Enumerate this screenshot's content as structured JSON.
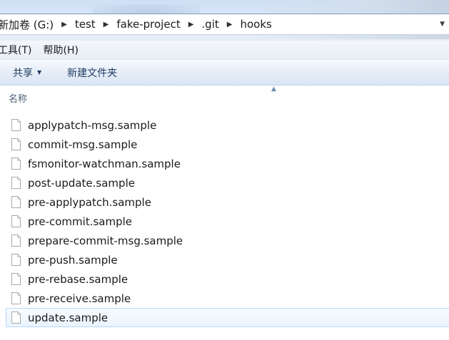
{
  "address": {
    "crumbs": [
      "新加卷 (G:)",
      "test",
      "fake-project",
      ".git",
      "hooks"
    ],
    "dropdown_icon": "chevron-down-icon"
  },
  "menu": {
    "items": [
      "工具(T)",
      "帮助(H)"
    ]
  },
  "toolbar": {
    "share_label": "共享",
    "new_folder_label": "新建文件夹"
  },
  "columns": {
    "name_label": "名称"
  },
  "files": [
    {
      "name": "applypatch-msg.sample"
    },
    {
      "name": "commit-msg.sample"
    },
    {
      "name": "fsmonitor-watchman.sample"
    },
    {
      "name": "post-update.sample"
    },
    {
      "name": "pre-applypatch.sample"
    },
    {
      "name": "pre-commit.sample"
    },
    {
      "name": "prepare-commit-msg.sample"
    },
    {
      "name": "pre-push.sample"
    },
    {
      "name": "pre-rebase.sample"
    },
    {
      "name": "pre-receive.sample"
    },
    {
      "name": "update.sample",
      "selected": true
    }
  ],
  "colors": {
    "selection_border": "#b8d6fb",
    "toolbar_text": "#1e3a5f"
  }
}
